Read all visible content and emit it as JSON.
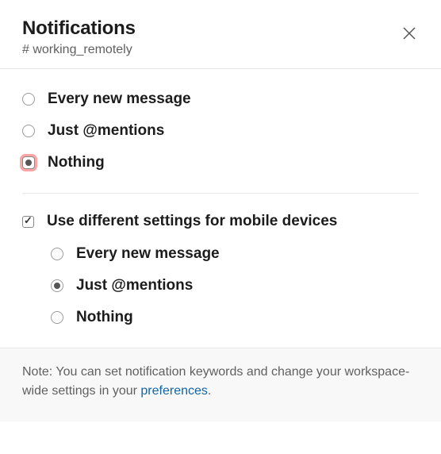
{
  "header": {
    "title": "Notifications",
    "channel": "# working_remotely"
  },
  "desktop": {
    "options": [
      {
        "label": "Every new message",
        "selected": false,
        "highlight": false
      },
      {
        "label": "Just @mentions",
        "selected": false,
        "highlight": false
      },
      {
        "label": "Nothing",
        "selected": true,
        "highlight": true
      }
    ]
  },
  "mobile": {
    "checkbox_label": "Use different settings for mobile devices",
    "checked": true,
    "options": [
      {
        "label": "Every new message",
        "selected": false
      },
      {
        "label": "Just @mentions",
        "selected": true
      },
      {
        "label": "Nothing",
        "selected": false
      }
    ]
  },
  "footer": {
    "note_prefix": "Note: You can set notification keywords and change your workspace-wide settings in your ",
    "link_text": "preferences",
    "note_suffix": "."
  }
}
